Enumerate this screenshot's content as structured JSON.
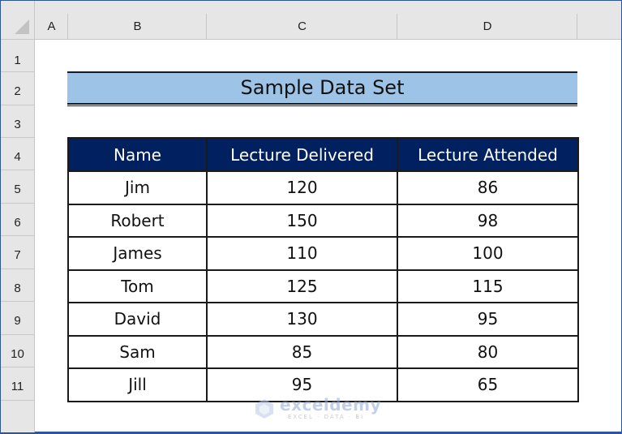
{
  "spreadsheet": {
    "columns": [
      "A",
      "B",
      "C",
      "D"
    ],
    "rows": [
      "1",
      "2",
      "3",
      "4",
      "5",
      "6",
      "7",
      "8",
      "9",
      "10",
      "11"
    ],
    "title": "Sample Data Set",
    "table": {
      "headers": [
        "Name",
        "Lecture Delivered",
        "Lecture Attended"
      ],
      "rows": [
        [
          "Jim",
          "120",
          "86"
        ],
        [
          "Robert",
          "150",
          "98"
        ],
        [
          "James",
          "110",
          "100"
        ],
        [
          "Tom",
          "125",
          "115"
        ],
        [
          "David",
          "130",
          "95"
        ],
        [
          "Sam",
          "85",
          "80"
        ],
        [
          "Jill",
          "95",
          "65"
        ]
      ]
    }
  },
  "watermark": {
    "name": "exceldemy",
    "tagline": "EXCEL · DATA · BI"
  },
  "colors": {
    "title_fill": "#9dc3e6",
    "header_fill": "#002060",
    "header_text": "#ffffff",
    "frame_accent": "#2b579a"
  }
}
